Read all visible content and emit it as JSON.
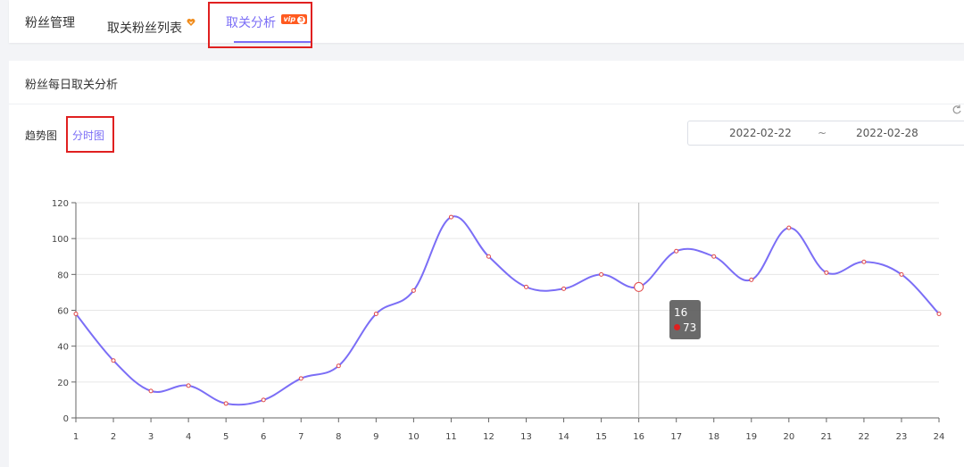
{
  "tabs": {
    "items": [
      {
        "label": "粉丝管理"
      },
      {
        "label": "取关粉丝列表"
      },
      {
        "label": "取关分析",
        "badge": "vip",
        "badge_level": "3"
      }
    ],
    "active_index": 2
  },
  "card": {
    "title": "粉丝每日取关分析"
  },
  "view_modes": {
    "trend_label": "趋势图",
    "hourly_label": "分时图",
    "active": "分时图"
  },
  "date_range": {
    "start": "2022-02-22",
    "separator": "~",
    "end": "2022-02-28"
  },
  "icons": {
    "favorite": "heart-icon",
    "refresh": "refresh-icon"
  },
  "colors": {
    "accent": "#7b6ef6",
    "point": "#e04848",
    "highlight_box": "#e02020",
    "vip_badge": "#ff5a1f"
  },
  "tooltip": {
    "x_label": "16",
    "value": "73"
  },
  "chart_data": {
    "type": "line",
    "x": [
      1,
      2,
      3,
      4,
      5,
      6,
      7,
      8,
      9,
      10,
      11,
      12,
      13,
      14,
      15,
      16,
      17,
      18,
      19,
      20,
      21,
      22,
      23,
      24
    ],
    "series": [
      {
        "values": [
          58,
          32,
          15,
          18,
          8,
          10,
          22,
          29,
          58,
          71,
          112,
          90,
          73,
          72,
          80,
          73,
          93,
          90,
          77,
          106,
          81,
          87,
          80,
          58
        ]
      }
    ],
    "ylim": [
      0,
      120
    ],
    "yticks": [
      0,
      20,
      40,
      60,
      80,
      100,
      120
    ],
    "grid": true,
    "smooth": true,
    "highlighted_x": 16
  }
}
